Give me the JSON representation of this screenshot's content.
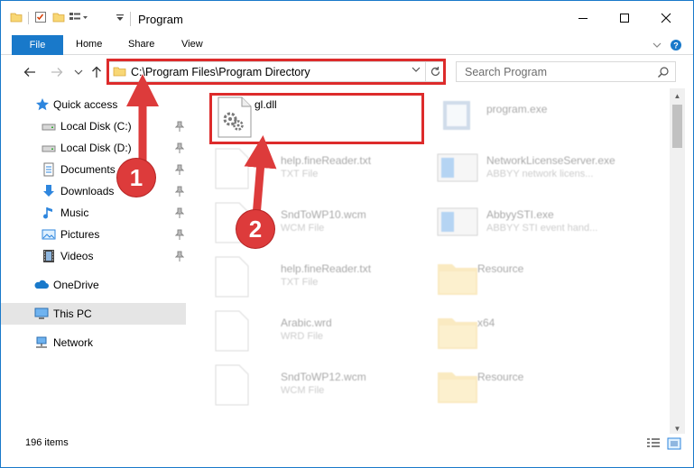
{
  "window": {
    "title": "Program",
    "controls": {
      "minimize": "minimize",
      "maximize": "maximize",
      "close": "close"
    }
  },
  "ribbon": {
    "tabs": [
      "File",
      "Home",
      "Share",
      "View"
    ]
  },
  "address_bar": {
    "path": "C:\\Program Files\\Program Directory"
  },
  "search": {
    "placeholder": "Search Program"
  },
  "nav_pane": {
    "items": [
      {
        "label": "Quick access",
        "icon": "star-icon"
      },
      {
        "label": "Local Disk (C:)",
        "icon": "drive-icon",
        "pinned": true
      },
      {
        "label": "Local Disk (D:)",
        "icon": "drive-icon",
        "pinned": true
      },
      {
        "label": "Documents",
        "icon": "documents-icon",
        "pinned": true
      },
      {
        "label": "Downloads",
        "icon": "downloads-icon",
        "pinned": true
      },
      {
        "label": "Music",
        "icon": "music-icon",
        "pinned": true
      },
      {
        "label": "Pictures",
        "icon": "pictures-icon",
        "pinned": true
      },
      {
        "label": "Videos",
        "icon": "videos-icon",
        "pinned": true
      },
      {
        "label": "OneDrive",
        "icon": "onedrive-icon"
      },
      {
        "label": "This PC",
        "icon": "computer-icon"
      },
      {
        "label": "Network",
        "icon": "network-icon"
      }
    ]
  },
  "files": [
    {
      "name": "gl.dll",
      "type": "",
      "icon": "dll-file-icon"
    },
    {
      "name": "program.exe",
      "type": "",
      "icon": "exe-file-icon"
    },
    {
      "name": "help.fineReader.txt",
      "type": "TXT File",
      "icon": "text-file-icon"
    },
    {
      "name": "NetworkLicenseServer.exe",
      "type": "ABBYY network licens...",
      "icon": "app-window-icon"
    },
    {
      "name": "SndToWP10.wcm",
      "type": "WCM File",
      "icon": "text-file-icon"
    },
    {
      "name": "AbbyySTI.exe",
      "type": "ABBYY STI event hand...",
      "icon": "app-window-icon"
    },
    {
      "name": "help.fineReader.txt",
      "type": "TXT File",
      "icon": "text-file-icon"
    },
    {
      "name": "Resource",
      "type": "",
      "icon": "folder-icon"
    },
    {
      "name": "Arabic.wrd",
      "type": "WRD File",
      "icon": "text-file-icon"
    },
    {
      "name": "x64",
      "type": "",
      "icon": "folder-icon"
    },
    {
      "name": "SndToWP12.wcm",
      "type": "WCM File",
      "icon": "text-file-icon"
    },
    {
      "name": "Resource",
      "type": "",
      "icon": "folder-icon"
    }
  ],
  "status": {
    "item_count": "196 items"
  },
  "annotations": {
    "step1": "1",
    "step2": "2",
    "color": "#dd2b2b"
  },
  "colors": {
    "accent": "#1979ca",
    "selection": "#cce8ff",
    "highlight_red": "#dd2b2b"
  }
}
